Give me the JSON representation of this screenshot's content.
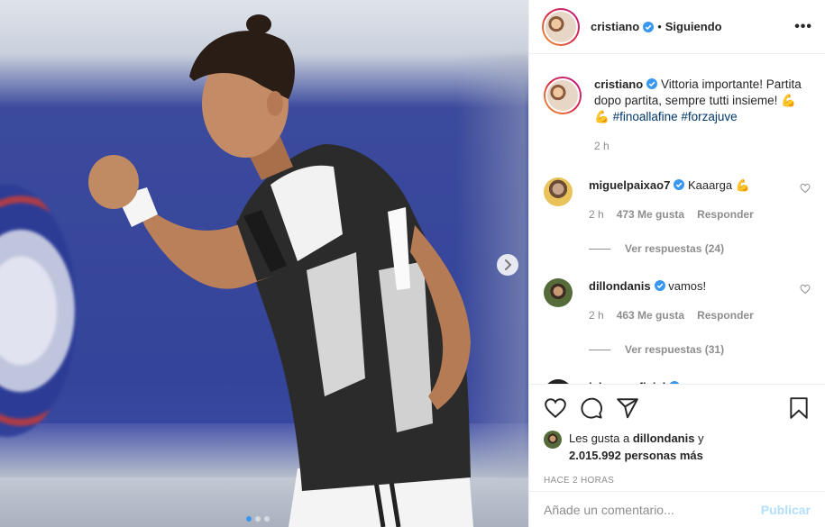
{
  "post": {
    "author": "cristiano",
    "follow_status": "Siguiendo",
    "separator": "•",
    "more_icon": "•••",
    "caption": {
      "text": "Vittoria importante! Partita dopo partita, sempre tutti insieme! 💪",
      "hashtag_prefix": "💪",
      "hashtags": [
        "#finoallafine",
        "#forzajuve"
      ],
      "time": "2 h"
    },
    "media": {
      "image_count": 3,
      "active_index": 0
    }
  },
  "comments": [
    {
      "user": "miguelpaixao7",
      "verified": true,
      "text": "Kaaarga 💪",
      "time": "2 h",
      "likes": "473 Me gusta",
      "reply": "Responder",
      "view_replies": "Ver respuestas (24)"
    },
    {
      "user": "dillondanis",
      "verified": true,
      "text": "vamos!",
      "time": "2 h",
      "likes": "463 Me gusta",
      "reply": "Responder",
      "view_replies": "Ver respuestas (31)"
    },
    {
      "user": "jalvarezoficial",
      "verified": true,
      "text": ""
    }
  ],
  "likes_line": {
    "prefix": "Les gusta a",
    "user": "dillondanis",
    "connector": "y",
    "count": "2.015.992 personas más"
  },
  "timestamp": "HACE 2 HORAS",
  "comment_box": {
    "placeholder": "Añade un comentario...",
    "publish": "Publicar"
  },
  "colors": {
    "verified": "#3897f0",
    "link": "#00376b",
    "publish_disabled": "#b2dffc",
    "muted": "#8e8e8e"
  }
}
